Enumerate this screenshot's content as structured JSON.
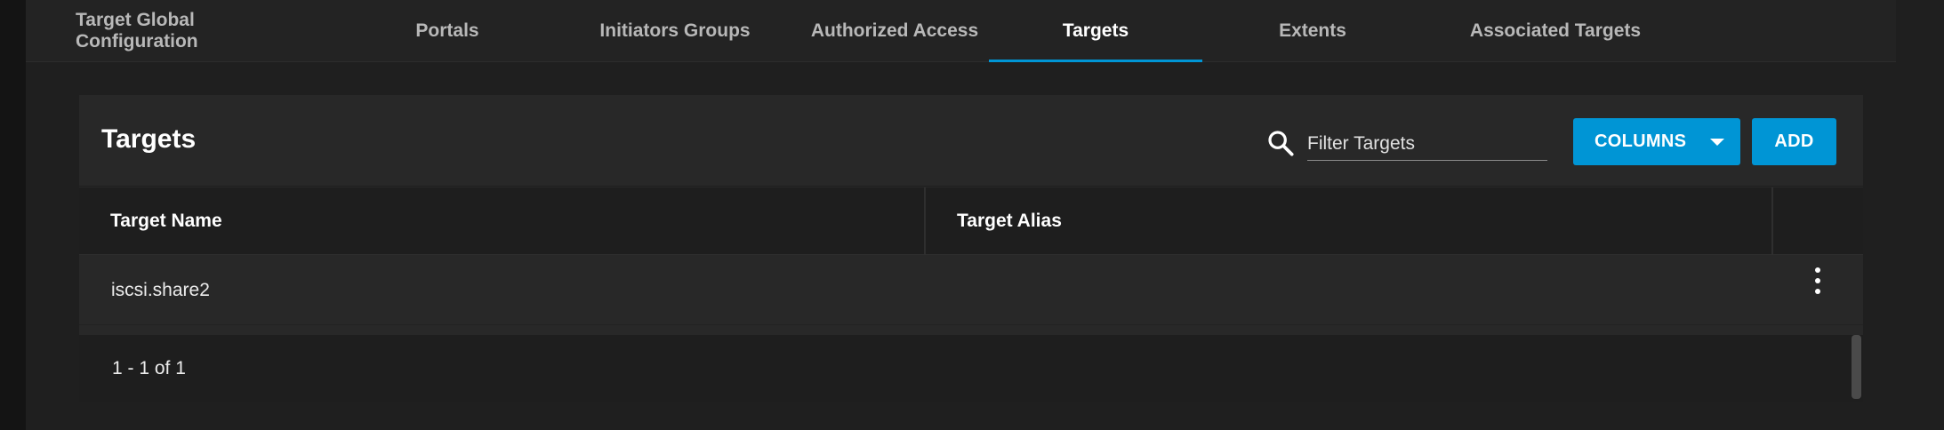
{
  "tabs": [
    {
      "label": "Target Global Configuration",
      "active": false
    },
    {
      "label": "Portals",
      "active": false
    },
    {
      "label": "Initiators Groups",
      "active": false
    },
    {
      "label": "Authorized Access",
      "active": false
    },
    {
      "label": "Targets",
      "active": true
    },
    {
      "label": "Extents",
      "active": false
    },
    {
      "label": "Associated Targets",
      "active": false
    }
  ],
  "card": {
    "title": "Targets",
    "search_placeholder": "Filter Targets",
    "columns_label": "COLUMNS",
    "add_label": "ADD"
  },
  "table": {
    "columns": [
      "Target Name",
      "Target Alias"
    ],
    "rows": [
      {
        "name": "iscsi.share2",
        "alias": ""
      }
    ]
  },
  "pagination": {
    "range": "1 - 1 of 1"
  },
  "colors": {
    "accent": "#0095d5",
    "background": "#1f1f1f",
    "card": "#282828"
  }
}
